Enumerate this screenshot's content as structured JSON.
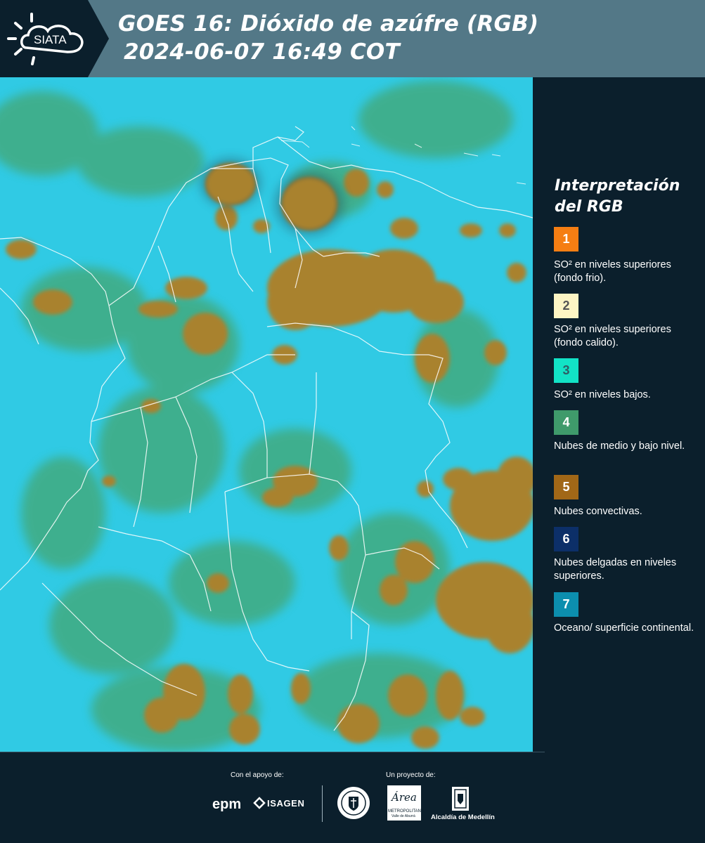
{
  "header": {
    "logo_text": "SIATA",
    "title_line1": "GOES 16: Dióxido de azúfre (RGB)",
    "title_line2": "2024-06-07 16:49 COT"
  },
  "legend": {
    "title": "Interpretación del RGB",
    "items": [
      {
        "number": "1",
        "color": "#f57e13",
        "number_color": "#ffffff",
        "text": "SO² en niveles superiores (fondo frio)."
      },
      {
        "number": "2",
        "color": "#fdf5c4",
        "number_color": "#555555",
        "text": "SO² en niveles superiores (fondo calido)."
      },
      {
        "number": "3",
        "color": "#12e3c6",
        "number_color": "#2e5e66",
        "text": "SO² en niveles bajos."
      },
      {
        "number": "4",
        "color": "#3f9a6b",
        "number_color": "#ffffff",
        "text": "Nubes de medio y bajo nivel."
      },
      {
        "number": "5",
        "color": "#a16717",
        "number_color": "#ffffff",
        "text": "Nubes convectivas."
      },
      {
        "number": "6",
        "color": "#0c2f68",
        "number_color": "#ffffff",
        "text": "Nubes delgadas en niveles superiores."
      },
      {
        "number": "7",
        "color": "#0c8eae",
        "number_color": "#ffffff",
        "text": "Oceano/ superficie continental."
      }
    ]
  },
  "footer": {
    "support_label": "Con el apoyo de:",
    "project_label": "Un proyecto de:",
    "epm": "epm",
    "isagen": "ISAGEN",
    "area": "Área",
    "metropolitana": "METROPOLITANA",
    "valle": "Valle de Aburrá",
    "alcaldia": "Alcaldía de Medellín"
  },
  "colors": {
    "header_bg": "#537887",
    "panel_bg": "#0b1f2c",
    "sky_cyan": "#2fc8e4",
    "cloud_brown": "#a9822f",
    "cloud_green": "#4b9a4a"
  }
}
